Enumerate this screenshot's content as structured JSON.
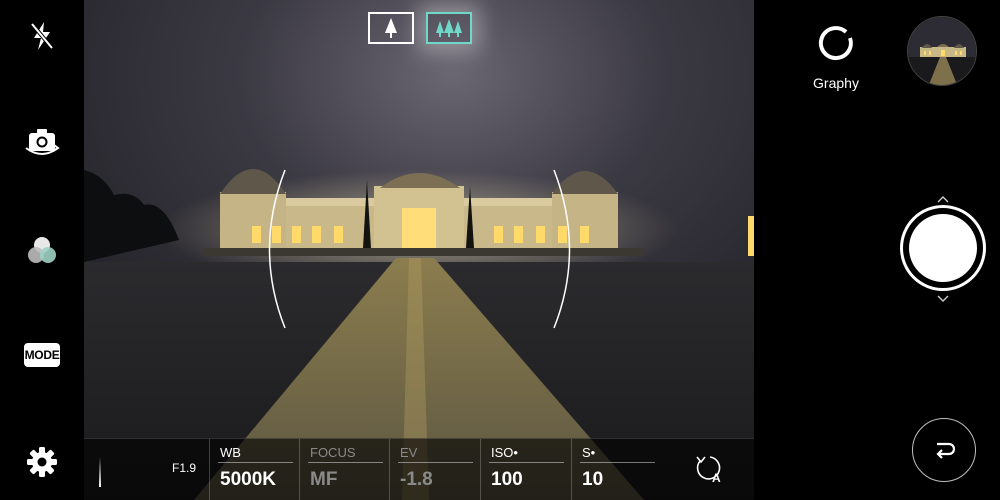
{
  "left_rail": {
    "flash": {
      "icon": "flash-off-icon"
    },
    "switch_camera": {
      "icon": "camera-switch-icon"
    },
    "filters": {
      "icon": "filter-icon"
    },
    "mode": {
      "label": "MODE"
    },
    "settings": {
      "icon": "gear-icon"
    }
  },
  "viewfinder": {
    "lens_selector": [
      {
        "icon": "single-tree-icon",
        "active": false
      },
      {
        "icon": "triple-tree-icon",
        "active": true
      }
    ]
  },
  "manual_bar": {
    "aperture": "F1.9",
    "params": [
      {
        "label": "WB",
        "value": "5000K",
        "enabled": true
      },
      {
        "label": "FOCUS",
        "value": "MF",
        "enabled": false
      },
      {
        "label": "EV",
        "value": "-1.8",
        "enabled": false
      },
      {
        "label": "ISO•",
        "value": "100",
        "enabled": true
      },
      {
        "label": "S•",
        "value": "10",
        "enabled": true
      }
    ],
    "auto_reset_label": "A"
  },
  "right_rail": {
    "graphy_label": "Graphy",
    "thumbnail": {
      "icon": "gallery-thumbnail"
    },
    "shutter": {
      "icon": "shutter-button"
    },
    "back": {
      "icon": "back-arrow-icon"
    }
  },
  "colors": {
    "accent": "#6fd8c8",
    "building_light": "#ffd96a",
    "sky": "#2a2a33"
  }
}
